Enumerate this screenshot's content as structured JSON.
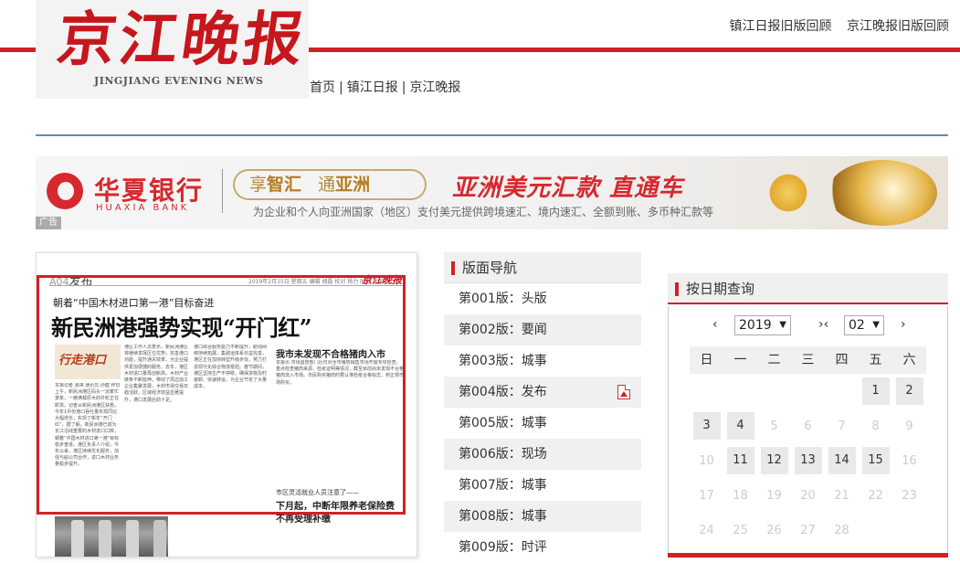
{
  "header": {
    "logo_cn": "京江晚报",
    "logo_en": "JINGJIANG EVENING NEWS",
    "top_links": [
      "镇江日报旧版回顾",
      "京江晚报旧版回顾"
    ],
    "nav": [
      "首页",
      "镇江日报",
      "京江晚报"
    ]
  },
  "ad": {
    "bank_cn": "华夏银行",
    "bank_en": "HUAXIA BANK",
    "pill_a1": "享",
    "pill_a2": "智汇",
    "pill_b1": "通",
    "pill_b2": "亚洲",
    "slogan": "亚洲美元汇款 直通车",
    "sub": "为企业和个人向亚洲国家（地区）支付美元提供跨境速汇、境内速汇、全额到账、多币种汇款等",
    "tag": "广告"
  },
  "paper": {
    "page_no": "A04",
    "page_name": "发布",
    "date_line": "2019年2月15日 星期五 编辑 胡磊 校对 杨力 时刻 叶天",
    "masthead": "京江晚报",
    "kicker": "朝着“中国木材进口第一港”目标奋进",
    "title": "新民洲港强势实现“开门红”",
    "sub1": "我市未发现不合格猪肉入市",
    "sub2": "市区灵活就业人员注意了——",
    "sub3": "下月起，中断年限养老保险费",
    "sub4": "不再受理补缴",
    "col_a": "本报记者 周祺 通讯员 孙健 昨日上午，新民洲港区码头一派繁忙景象，一艘满载原木的外轮正在卸货。记者从新民洲港区获悉，今年1月份港口吞吐量实现同比大幅增长，实现了新年“开门红”。据了解，新民洲港已成为长江沿线重要的木材进口口岸，朝着“中国木材进口第一港”目标稳步奋进。港区负责人介绍，今年以来，港区持续优化服务，加强与船公司合作，进口木材业务量稳步提升。",
    "col_b": "港区工作人员表示，新民洲港区将继续发挥区位优势，完善港口功能，提升通关效率，为企业提供更加便捷的服务。去年，港区木材进口量再创新高，木材产业链条不断延伸，带动了周边加工企业集聚发展，木材市场交易日趋活跃，区域经济效益显著提升，港口发展后劲十足。",
    "col_c": "港口综合服务能力不断提升，航线网络持续拓展，集疏运体系日益完善，港区正在加快转型升级步伐，努力打造现代化综合物流枢纽。春节期间，港区坚持生产不停歇，确保货物及时装卸、快速转运，为企业节省了大量成本。",
    "col_d": "本报讯 市场监管部门近日对全市猪肉销售市场开展专项检查，重点检查猪肉来源、检疫证明等情况，截至目前尚未发现不合格猪肉流入市场。市民购买猪肉时要认准检疫合格标志，到正规市场购买。"
  },
  "section_nav": {
    "title": "版面导航",
    "items": [
      {
        "label": "第001版：头版",
        "pdf": false
      },
      {
        "label": "第002版：要闻",
        "pdf": false
      },
      {
        "label": "第003版：城事",
        "pdf": false
      },
      {
        "label": "第004版：发布",
        "pdf": true
      },
      {
        "label": "第005版：城事",
        "pdf": false
      },
      {
        "label": "第006版：现场",
        "pdf": false
      },
      {
        "label": "第007版：城事",
        "pdf": false
      },
      {
        "label": "第008版：城事",
        "pdf": false
      },
      {
        "label": "第009版：时评",
        "pdf": false
      }
    ]
  },
  "calendar": {
    "title": "按日期查询",
    "prev": "‹",
    "next": "›",
    "mid": "›‹",
    "year": "2019",
    "month": "02",
    "weekdays": [
      "日",
      "一",
      "二",
      "三",
      "四",
      "五",
      "六"
    ],
    "weeks": [
      [
        {
          "d": ""
        },
        {
          "d": ""
        },
        {
          "d": ""
        },
        {
          "d": ""
        },
        {
          "d": ""
        },
        {
          "d": "1",
          "on": true
        },
        {
          "d": "2",
          "on": true
        }
      ],
      [
        {
          "d": "3",
          "on": true
        },
        {
          "d": "4",
          "on": true
        },
        {
          "d": "5"
        },
        {
          "d": "6"
        },
        {
          "d": "7"
        },
        {
          "d": "8"
        },
        {
          "d": "9"
        }
      ],
      [
        {
          "d": "10"
        },
        {
          "d": "11",
          "on": true
        },
        {
          "d": "12",
          "on": true
        },
        {
          "d": "13",
          "on": true
        },
        {
          "d": "14",
          "on": true
        },
        {
          "d": "15",
          "on": true
        },
        {
          "d": "16"
        }
      ],
      [
        {
          "d": "17"
        },
        {
          "d": "18"
        },
        {
          "d": "19"
        },
        {
          "d": "20"
        },
        {
          "d": "21"
        },
        {
          "d": "22"
        },
        {
          "d": "23"
        }
      ],
      [
        {
          "d": "24"
        },
        {
          "d": "25"
        },
        {
          "d": "26"
        },
        {
          "d": "27"
        },
        {
          "d": "28"
        },
        {
          "d": ""
        },
        {
          "d": ""
        }
      ]
    ]
  }
}
